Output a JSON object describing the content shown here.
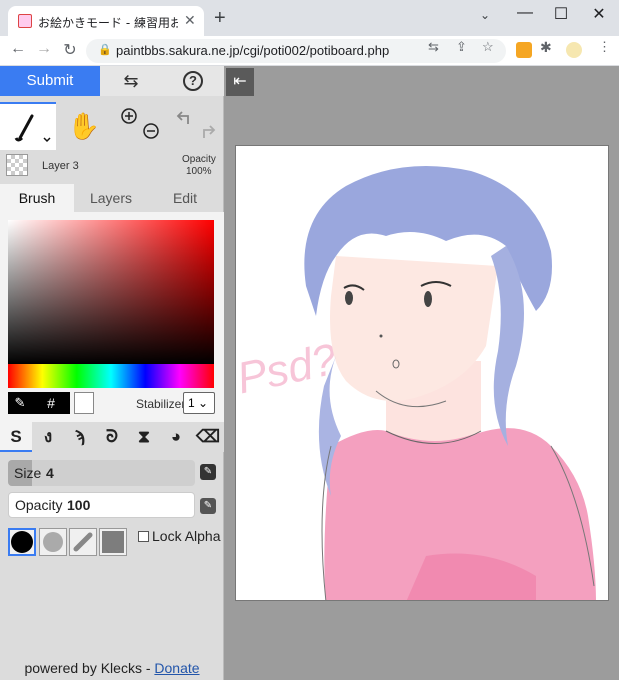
{
  "browser": {
    "tab_title": "お絵かきモード - 練習用お絵かき掲示",
    "url": "paintbbs.sakura.ne.jp/cgi/poti002/potiboard.php",
    "new_tab": "+",
    "close": "✕"
  },
  "panel": {
    "submit": "Submit",
    "help": "?",
    "layer": {
      "name": "Layer 3",
      "opacity_label": "Opacity",
      "opacity_value": "100%"
    },
    "tabs": [
      "Brush",
      "Layers",
      "Edit"
    ],
    "color": {
      "hex_label": "#",
      "stabilizer_label": "Stabilizer",
      "stabilizer_value": "1"
    },
    "size": {
      "label": "Size",
      "value": "4",
      "fraction": 0.13
    },
    "opacity": {
      "label": "Opacity",
      "value": "100"
    },
    "lock_alpha": "Lock Alpha",
    "footer": {
      "powered": "powered by Klecks - ",
      "donate": "Donate"
    }
  },
  "canvas": {
    "handwritten_text": "Psd?"
  },
  "colors": {
    "accent": "#3a7cf2",
    "hair": "#9aa6dc",
    "shirt": "#f28bb0"
  }
}
